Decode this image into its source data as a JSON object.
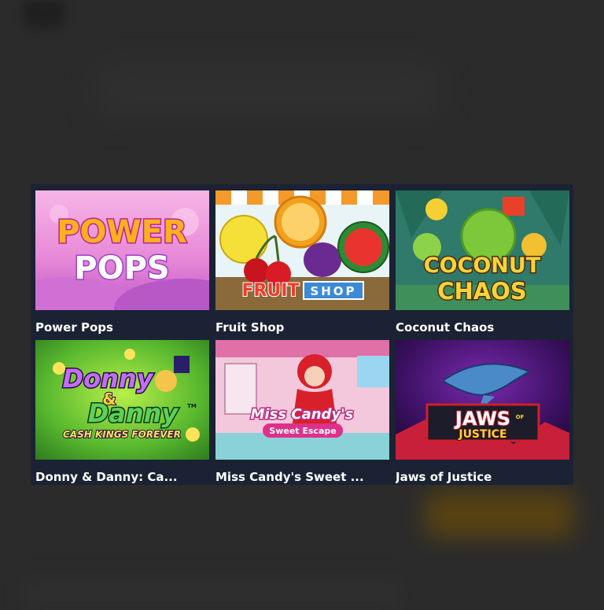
{
  "games": [
    {
      "title": "Power Pops",
      "logo_line1": "POWER",
      "logo_line2": "POPS"
    },
    {
      "title": "Fruit Shop",
      "logo_line1": "FRUIT",
      "logo_line2": "SHOP"
    },
    {
      "title": "Coconut Chaos",
      "logo_line1": "COCONUT",
      "logo_line2": "CHAOS"
    },
    {
      "title": "Donny & Danny: Ca...",
      "logo_line1": "Donny",
      "logo_amp": "&",
      "logo_line2": "Danny",
      "logo_tm": "TM",
      "logo_tagline": "CASH KINGS FOREVER"
    },
    {
      "title": "Miss Candy's Sweet ...",
      "logo_line1": "Miss Candy's",
      "logo_line2": "Sweet Escape"
    },
    {
      "title": "Jaws of Justice",
      "logo_line1": "JAWS",
      "logo_of": "OF",
      "logo_line2": "JUSTICE"
    }
  ]
}
